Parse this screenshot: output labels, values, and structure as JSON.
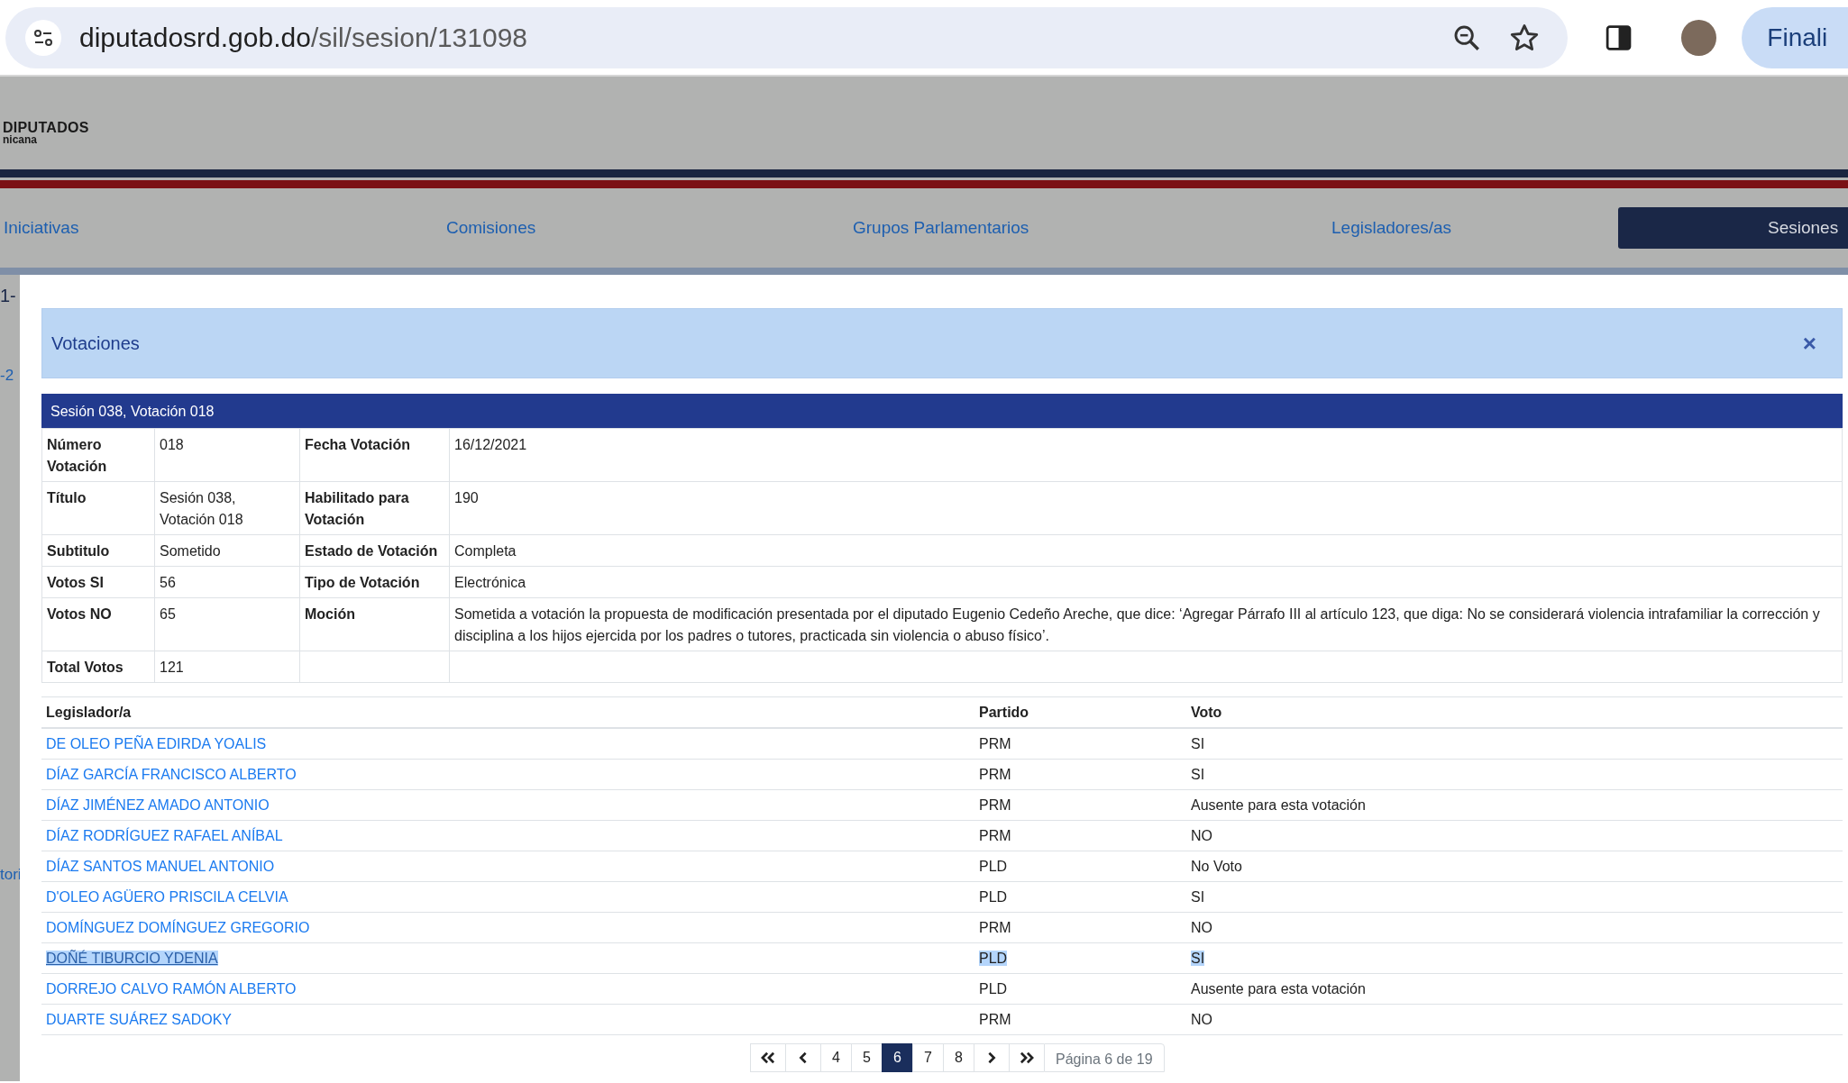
{
  "browser": {
    "url_host": "diputadosrd.gob.do",
    "url_path": "/sil/sesion/131098",
    "profile_button": "Finali"
  },
  "site_header": {
    "logo_title": "DIPUTADOS",
    "logo_subtitle": "nicana"
  },
  "nav": [
    {
      "label": "Iniciativas",
      "selected": false
    },
    {
      "label": "Comisiones",
      "selected": false
    },
    {
      "label": "Grupos Parlamentarios",
      "selected": false
    },
    {
      "label": "Legisladores/as",
      "selected": false
    },
    {
      "label": "Sesiones",
      "selected": true
    }
  ],
  "background_fragments": [
    "1-",
    "-2",
    "tori"
  ],
  "modal": {
    "title": "Votaciones",
    "close": "×",
    "detail_title": "Sesión 038, Votación 018",
    "details": [
      {
        "label_1": "Número Votación",
        "value_1": "018",
        "label_2": "Fecha Votación",
        "value_2": "16/12/2021"
      },
      {
        "label_1": "Título",
        "value_1": "Sesión 038, Votación 018",
        "label_2": "Habilitado para Votación",
        "value_2": "190"
      },
      {
        "label_1": "Subtitulo",
        "value_1": "Sometido",
        "label_2": "Estado de Votación",
        "value_2": "Completa"
      },
      {
        "label_1": "Votos SI",
        "value_1": "56",
        "label_2": "Tipo de Votación",
        "value_2": "Electrónica"
      },
      {
        "label_1": "Votos NO",
        "value_1": "65",
        "label_2": "Moción",
        "value_2": "Sometida a votación la propuesta de modificación presentada por el diputado Eugenio Cedeño Areche, que dice: ‘Agregar Párrafo III al artículo 123, que diga: No se considerará violencia intrafamiliar la corrección y disciplina a los hijos ejercida por los padres o tutores, practicada sin violencia o abuso físico’."
      },
      {
        "label_1": "Total Votos",
        "value_1": "121"
      }
    ],
    "votes_table": {
      "columns": [
        "Legislador/a",
        "Partido",
        "Voto"
      ],
      "rows": [
        {
          "legislator": "DE OLEO PEÑA EDIRDA YOALIS",
          "party": "PRM",
          "vote": "SI",
          "selected": false
        },
        {
          "legislator": "DÍAZ GARCÍA FRANCISCO ALBERTO",
          "party": "PRM",
          "vote": "SI",
          "selected": false
        },
        {
          "legislator": "DÍAZ JIMÉNEZ AMADO ANTONIO",
          "party": "PRM",
          "vote": "Ausente para esta votación",
          "selected": false
        },
        {
          "legislator": "DÍAZ RODRÍGUEZ RAFAEL ANÍBAL",
          "party": "PRM",
          "vote": "NO",
          "selected": false
        },
        {
          "legislator": "DÍAZ SANTOS MANUEL ANTONIO",
          "party": "PLD",
          "vote": "No Voto",
          "selected": false
        },
        {
          "legislator": "D'OLEO AGÜERO PRISCILA CELVIA",
          "party": "PLD",
          "vote": "SI",
          "selected": false
        },
        {
          "legislator": "DOMÍNGUEZ DOMÍNGUEZ GREGORIO",
          "party": "PRM",
          "vote": "NO",
          "selected": false
        },
        {
          "legislator": "DOÑÉ TIBURCIO YDENIA",
          "party": "PLD",
          "vote": "SI",
          "selected": true
        },
        {
          "legislator": "DORREJO CALVO RAMÓN ALBERTO",
          "party": "PLD",
          "vote": "Ausente para esta votación",
          "selected": false
        },
        {
          "legislator": "DUARTE SUÁREZ SADOKY",
          "party": "PRM",
          "vote": "NO",
          "selected": false
        }
      ]
    },
    "pagination": {
      "pages": [
        {
          "label": "4",
          "selected": false
        },
        {
          "label": "5",
          "selected": false
        },
        {
          "label": "6",
          "selected": true
        },
        {
          "label": "7",
          "selected": false
        },
        {
          "label": "8",
          "selected": false
        }
      ],
      "status": "Página 6 de 19"
    }
  }
}
